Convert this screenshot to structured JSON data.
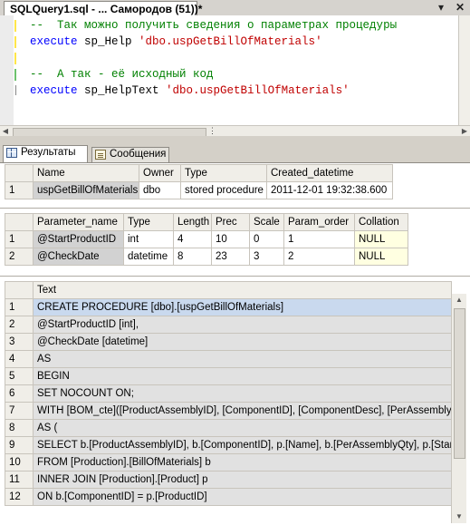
{
  "document_tab": {
    "title": "SQLQuery1.sql - ... Самородов (51))*",
    "pin_glyph": "▾",
    "close_glyph": "✕"
  },
  "editor": {
    "lines": [
      {
        "parts": [
          {
            "t": "--  Так можно получить сведения о параметрах процедуры",
            "c": "comment"
          }
        ]
      },
      {
        "parts": [
          {
            "t": "execute",
            "c": "keyword"
          },
          {
            "t": " sp_Help ",
            "c": "plain"
          },
          {
            "t": "'dbo.uspGetBillOfMaterials'",
            "c": "str"
          }
        ]
      },
      {
        "parts": []
      },
      {
        "parts": [
          {
            "t": "--  А так - её исходный код",
            "c": "comment"
          }
        ]
      },
      {
        "parts": [
          {
            "t": "execute",
            "c": "keyword"
          },
          {
            "t": " sp_HelpText ",
            "c": "plain"
          },
          {
            "t": "'dbo.uspGetBillOfMaterials'",
            "c": "str"
          }
        ]
      }
    ]
  },
  "result_tabs": {
    "results_label": "Результаты",
    "messages_label": "Сообщения"
  },
  "grid1": {
    "columns": [
      "Name",
      "Owner",
      "Type",
      "Created_datetime"
    ],
    "rows": [
      {
        "num": "1",
        "cells": [
          "uspGetBillOfMaterials",
          "dbo",
          "stored procedure",
          "2011-12-01 19:32:38.600"
        ]
      }
    ]
  },
  "grid2": {
    "columns": [
      "Parameter_name",
      "Type",
      "Length",
      "Prec",
      "Scale",
      "Param_order",
      "Collation"
    ],
    "rows": [
      {
        "num": "1",
        "cells": [
          "@StartProductID",
          "int",
          "4",
          "10",
          "0",
          "1",
          "NULL"
        ]
      },
      {
        "num": "2",
        "cells": [
          "@CheckDate",
          "datetime",
          "8",
          "23",
          "3",
          "2",
          "NULL"
        ]
      }
    ]
  },
  "grid3": {
    "columns": [
      "Text"
    ],
    "rows": [
      {
        "num": "1",
        "cells": [
          "CREATE PROCEDURE [dbo].[uspGetBillOfMaterials]"
        ]
      },
      {
        "num": "2",
        "cells": [
          "@StartProductID [int],"
        ]
      },
      {
        "num": "3",
        "cells": [
          "@CheckDate [datetime]"
        ]
      },
      {
        "num": "4",
        "cells": [
          "AS"
        ]
      },
      {
        "num": "5",
        "cells": [
          "BEGIN"
        ]
      },
      {
        "num": "6",
        "cells": [
          "SET NOCOUNT ON;"
        ]
      },
      {
        "num": "7",
        "cells": [
          "WITH [BOM_cte]([ProductAssemblyID], [ComponentID], [ComponentDesc], [PerAssemblyQty], [S"
        ]
      },
      {
        "num": "8",
        "cells": [
          "AS ("
        ]
      },
      {
        "num": "9",
        "cells": [
          "SELECT b.[ProductAssemblyID], b.[ComponentID], p.[Name], b.[PerAssemblyQty], p.[StandardCo"
        ]
      },
      {
        "num": "10",
        "cells": [
          "FROM [Production].[BillOfMaterials] b"
        ]
      },
      {
        "num": "11",
        "cells": [
          "INNER JOIN [Production].[Product] p"
        ]
      },
      {
        "num": "12",
        "cells": [
          "ON b.[ComponentID] = p.[ProductID]"
        ]
      }
    ]
  }
}
